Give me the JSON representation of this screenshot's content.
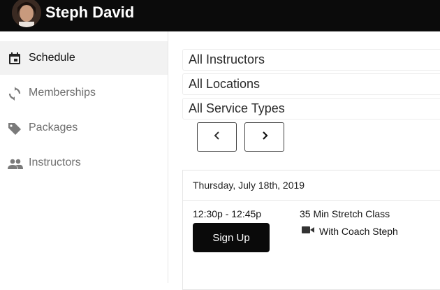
{
  "header": {
    "user_name": "Steph David"
  },
  "sidebar": {
    "items": [
      {
        "label": "Schedule",
        "icon": "calendar-icon",
        "active": true
      },
      {
        "label": "Memberships",
        "icon": "refresh-icon",
        "active": false
      },
      {
        "label": "Packages",
        "icon": "tag-icon",
        "active": false
      },
      {
        "label": "Instructors",
        "icon": "people-icon",
        "active": false
      }
    ]
  },
  "filters": {
    "instructors": "All Instructors",
    "locations": "All Locations",
    "service_types": "All Service Types"
  },
  "pager": {
    "prev_icon": "chevron-left-icon",
    "next_icon": "chevron-right-icon"
  },
  "schedule": {
    "date": "Thursday, July 18th, 2019",
    "classes": [
      {
        "time": "12:30p - 12:45p",
        "name": "35 Min Stretch Class",
        "coach": "With Coach Steph",
        "coach_icon": "video-camera-icon",
        "signup_label": "Sign Up"
      }
    ]
  },
  "colors": {
    "topbar": "#0b0b0b",
    "accent": "#0a0a0a",
    "active_nav_bg": "#f2f2f2",
    "muted_text": "#6f6f6f"
  }
}
